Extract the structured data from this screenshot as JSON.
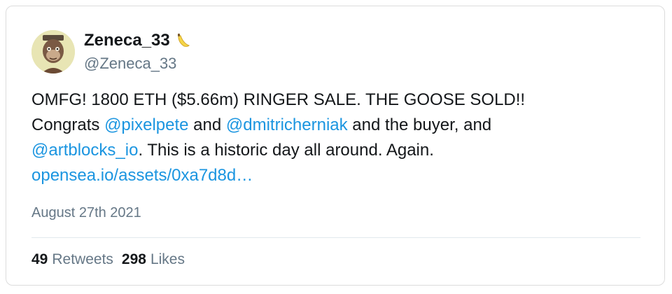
{
  "author": {
    "display_name": "Zeneca_33",
    "handle": "@Zeneca_33",
    "name_emoji": "banana-icon"
  },
  "tweet": {
    "line1": "OMFG! 1800 ETH ($5.66m) RINGER SALE. THE GOOSE SOLD!!",
    "line2_pre": "Congrats ",
    "mention1": "@pixelpete",
    "line2_mid": " and ",
    "mention2": "@dmitricherniak",
    "line2_post": " and the buyer, and",
    "mention3": "@artblocks_io",
    "line3_post": ". This is a historic day all around. Again.",
    "url": "opensea.io/assets/0xa7d8d…"
  },
  "date": "August 27th 2021",
  "stats": {
    "retweets_count": "49",
    "retweets_label": "Retweets",
    "likes_count": "298",
    "likes_label": "Likes"
  },
  "colors": {
    "link": "#1b95e0",
    "secondary_text": "#657786",
    "primary_text": "#14171a"
  }
}
